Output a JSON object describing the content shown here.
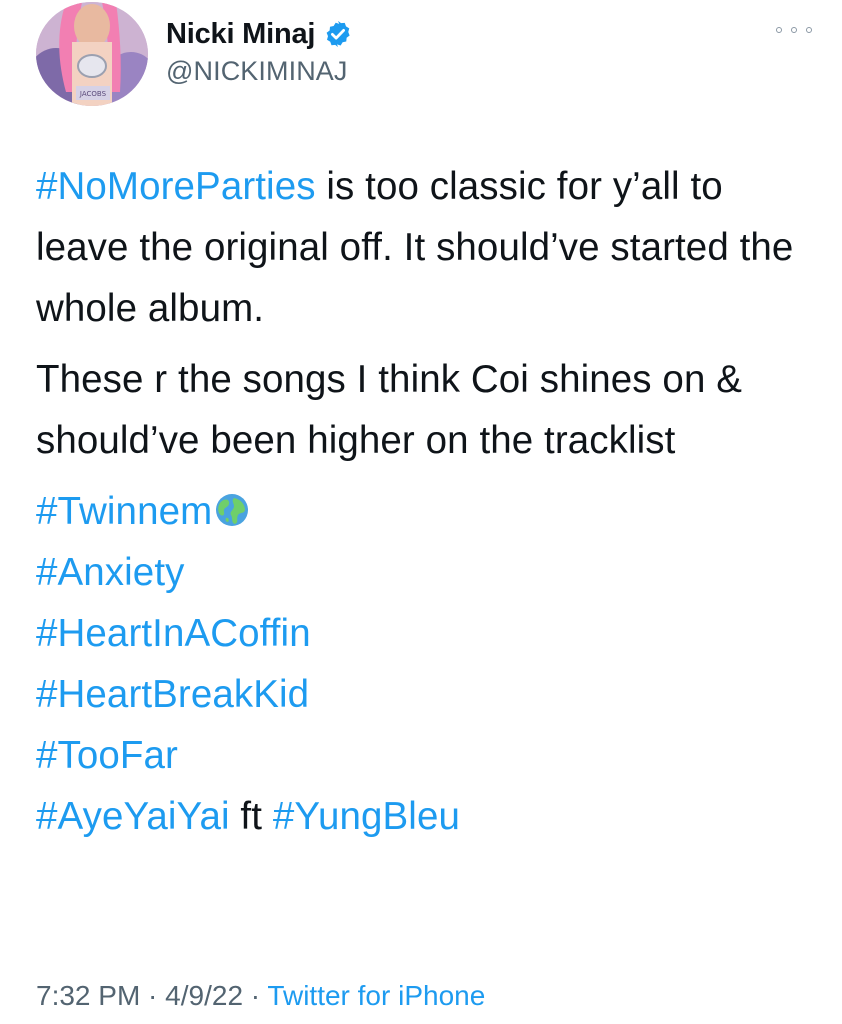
{
  "author": {
    "display_name": "Nicki Minaj",
    "handle": "@NICKIMINAJ",
    "verified_icon": "verified-badge-icon",
    "avatar_icon": "profile-photo"
  },
  "menu_icon": "more-options-icon",
  "tweet": {
    "line1_tag": "#NoMoreParties",
    "line1_rest": " is too classic for y’all to leave the original off. It should’ve started the whole album.",
    "para2": "These r the songs I think Coi shines on & should’ve been higher on the tracklist",
    "tags": {
      "twinnem": "#Twinnem",
      "twinnem_emoji": "earth-globe-emoji",
      "anxiety": "#Anxiety",
      "heart_in_a_coffin": "#HeartInACoffin",
      "heart_break_kid": "#HeartBreakKid",
      "too_far": "#TooFar",
      "aye_yai_yai": "#AyeYaiYai",
      "ft": " ft ",
      "yung_bleu": "#YungBleu"
    }
  },
  "meta": {
    "time": "7:32 PM",
    "sep1": " · ",
    "date": "4/9/22",
    "sep2": " · ",
    "source": "Twitter for iPhone"
  },
  "colors": {
    "link": "#1d9bf0",
    "text": "#0f1419",
    "secondary": "#536471"
  }
}
